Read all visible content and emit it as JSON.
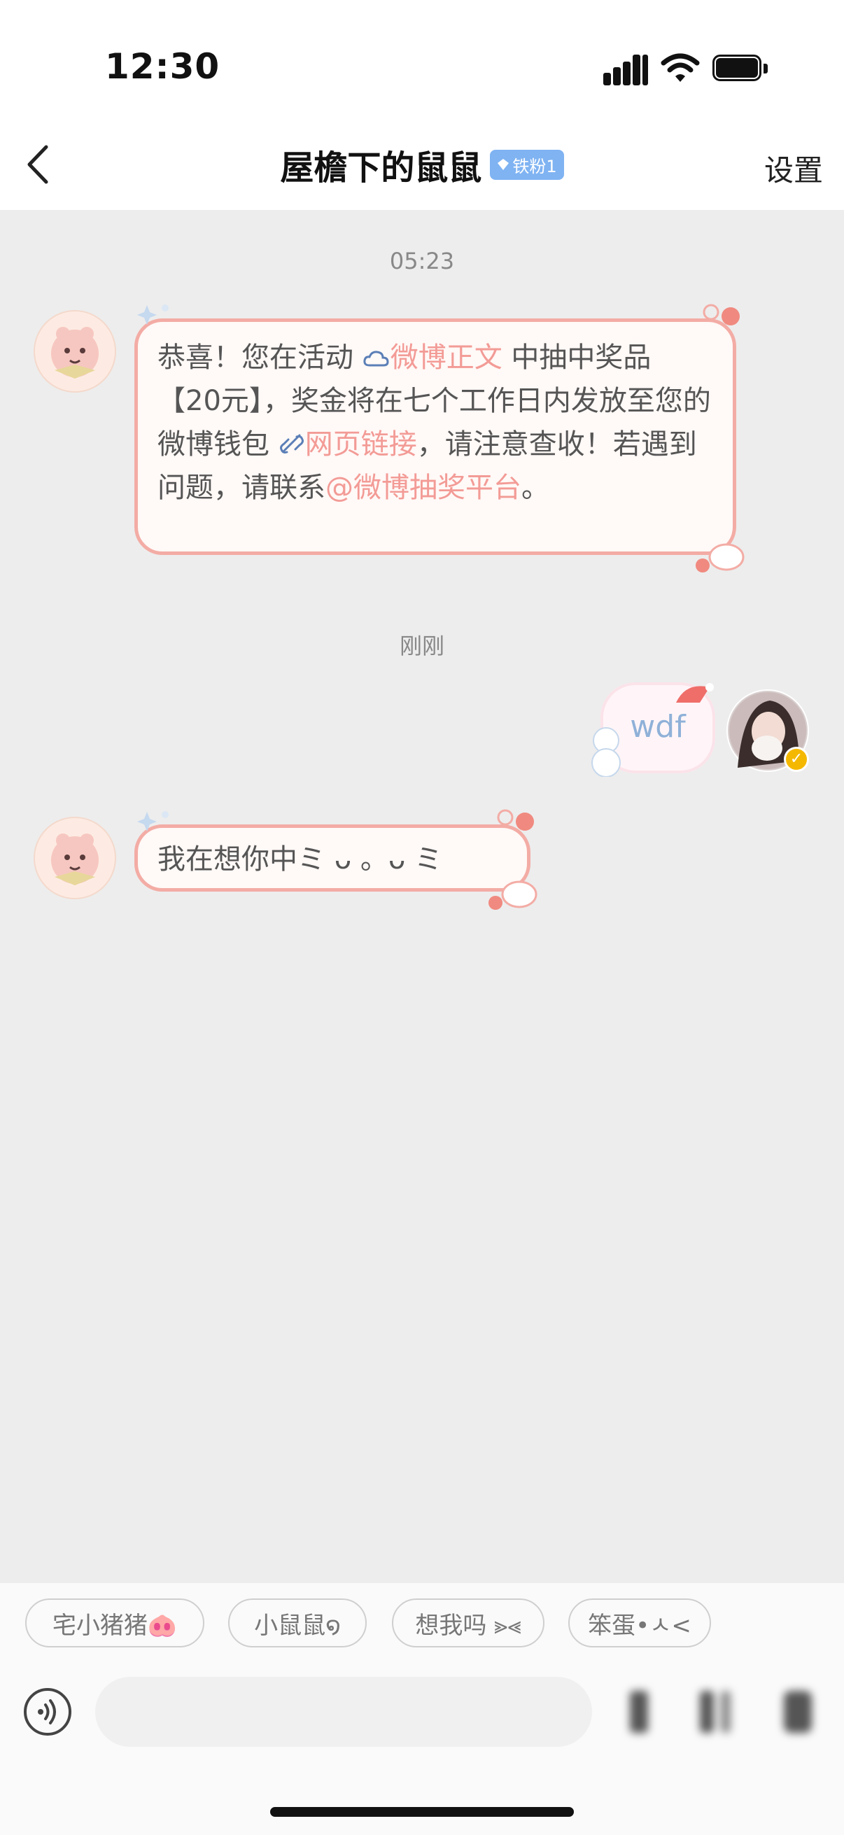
{
  "status_bar": {
    "time": "12:30"
  },
  "header": {
    "title": "屋檐下的鼠鼠",
    "fan_badge": "铁粉1",
    "settings_label": "设置"
  },
  "messages": {
    "ts1": "05:23",
    "msg1": {
      "p1": "恭喜！您在活动 ",
      "link1": "微博正文",
      "p2": " 中抽中奖品【20元】，奖金将在七个工作日内发放至您的微博钱包 ",
      "link2": "网页链接",
      "p3": "，请注意查收！若遇到问题，请联系",
      "link3": "@微博抽奖平台",
      "p4": "。"
    },
    "ts2": "刚刚",
    "my_msg": "wdf",
    "msg2": "我在想你中ミ ᴗ 。ᴗ ミ"
  },
  "quick_replies": [
    "宅小猪猪🐽",
    "小鼠鼠໑",
    "想我吗 ⪢⪡",
    "笨蛋•ㅅ<"
  ],
  "colors": {
    "accent": "#f39b96",
    "bubble_border": "#f3aca5",
    "background": "#ededed",
    "badge": "#7fb3f2"
  }
}
